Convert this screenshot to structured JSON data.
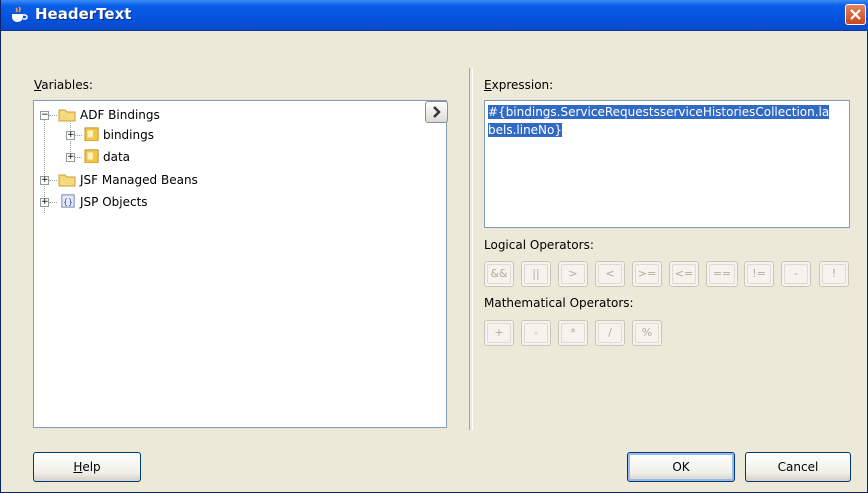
{
  "window": {
    "title": "HeaderText",
    "icon": "java-cup-icon",
    "accent_color": "#0553df",
    "close_icon": "close-icon"
  },
  "variables": {
    "label_mnemonic": "V",
    "label_rest": "ariables:",
    "tree": [
      {
        "label": "ADF Bindings",
        "expanded": true,
        "icon": "folder-icon"
      },
      {
        "label": "bindings",
        "expanded": false,
        "icon": "bean-folder-icon"
      },
      {
        "label": "data",
        "expanded": false,
        "icon": "bean-folder-icon"
      },
      {
        "label": "JSF Managed Beans",
        "expanded": false,
        "icon": "folder-icon"
      },
      {
        "label": "JSP Objects",
        "expanded": false,
        "icon": "jsp-objects-icon"
      }
    ],
    "insert_button_icon": "chevron-right-icon"
  },
  "expression": {
    "label_mnemonic": "E",
    "label_rest": "xpression:",
    "line1": "#{bindings.ServiceRequestsserviceHistoriesCollection.la",
    "line2": "bels.lineNo}",
    "selection_color": "#316ac5"
  },
  "logical": {
    "label": "Logical Operators:",
    "operators": [
      "&&",
      "||",
      ">",
      "<",
      ">=",
      "<=",
      "==",
      "!=",
      "-",
      "!"
    ]
  },
  "math": {
    "label": "Mathematical Operators:",
    "operators": [
      "+",
      "-",
      "*",
      "/",
      "%"
    ]
  },
  "buttons": {
    "help_mnemonic": "H",
    "help_rest": "elp",
    "ok": "OK",
    "cancel": "Cancel"
  }
}
